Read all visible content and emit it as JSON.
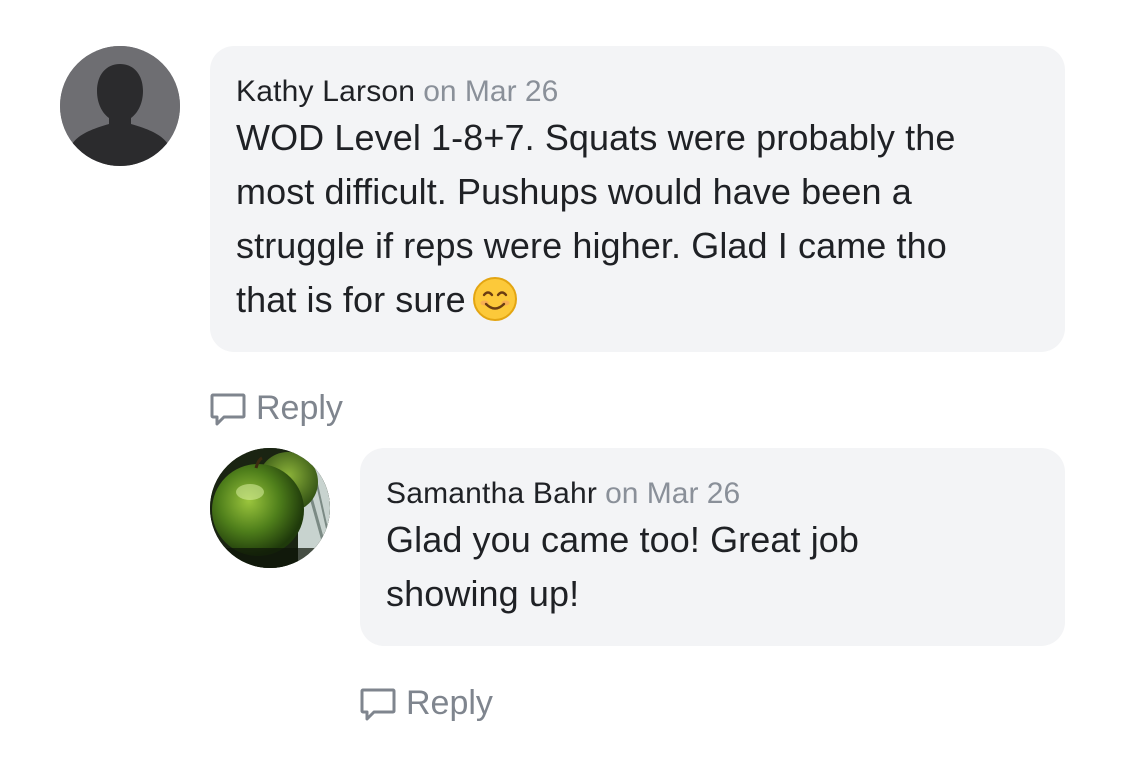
{
  "comments": [
    {
      "author": "Kathy Larson",
      "date": "on Mar 26",
      "text_lines": [
        "WOD Level 1-8+7. Squats were probably the",
        "most difficult. Pushups would have been a",
        "struggle if reps were higher. Glad I came tho",
        "that is for sure"
      ],
      "emoji": "smiling-face-emoji",
      "avatar": "default-silhouette-avatar",
      "reply_label": "Reply"
    },
    {
      "author": "Samantha Bahr",
      "date": "on Mar 26",
      "text_lines": [
        "Glad you came too! Great job",
        "showing up!"
      ],
      "avatar": "green-apple-avatar",
      "reply_label": "Reply"
    }
  ],
  "colors": {
    "bubble_bg": "#f3f4f6",
    "meta_gray": "#8a9099",
    "reply_gray": "#7f858e",
    "text": "#1f2125"
  },
  "icons": {
    "reply": "comment-bubble-icon"
  }
}
